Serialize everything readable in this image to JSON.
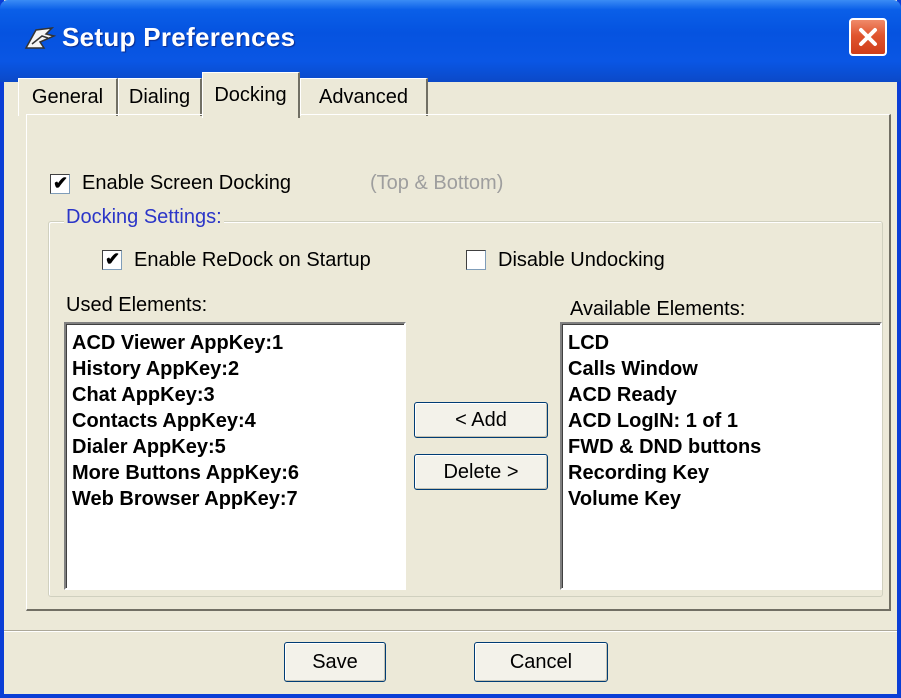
{
  "window": {
    "title": "Setup Preferences"
  },
  "tabs": [
    {
      "label": "General"
    },
    {
      "label": "Dialing"
    },
    {
      "label": "Docking",
      "active": true
    },
    {
      "label": "Advanced"
    }
  ],
  "docking": {
    "enable_screen_docking": {
      "label": "Enable Screen Docking",
      "checked": true,
      "hint": "(Top & Bottom)"
    },
    "group_title": "Docking Settings:",
    "enable_redock": {
      "label": "Enable ReDock on Startup",
      "checked": true
    },
    "disable_undocking": {
      "label": "Disable Undocking",
      "checked": false
    },
    "used_elements": {
      "label": "Used Elements:",
      "items": [
        "ACD Viewer AppKey:1",
        "History AppKey:2",
        "Chat AppKey:3",
        "Contacts AppKey:4",
        "Dialer AppKey:5",
        "More Buttons AppKey:6",
        "Web Browser AppKey:7"
      ]
    },
    "available_elements": {
      "label": "Available Elements:",
      "items": [
        "LCD",
        "Calls Window",
        "ACD Ready",
        "ACD LogIN: 1 of 1",
        "FWD & DND buttons",
        "Recording Key",
        "Volume Key"
      ]
    },
    "add_label": "< Add",
    "delete_label": "Delete >"
  },
  "footer": {
    "save_label": "Save",
    "cancel_label": "Cancel"
  },
  "colors": {
    "titlebar": "#0553e0",
    "group_title": "#2b35c8",
    "close": "#e0552f"
  }
}
